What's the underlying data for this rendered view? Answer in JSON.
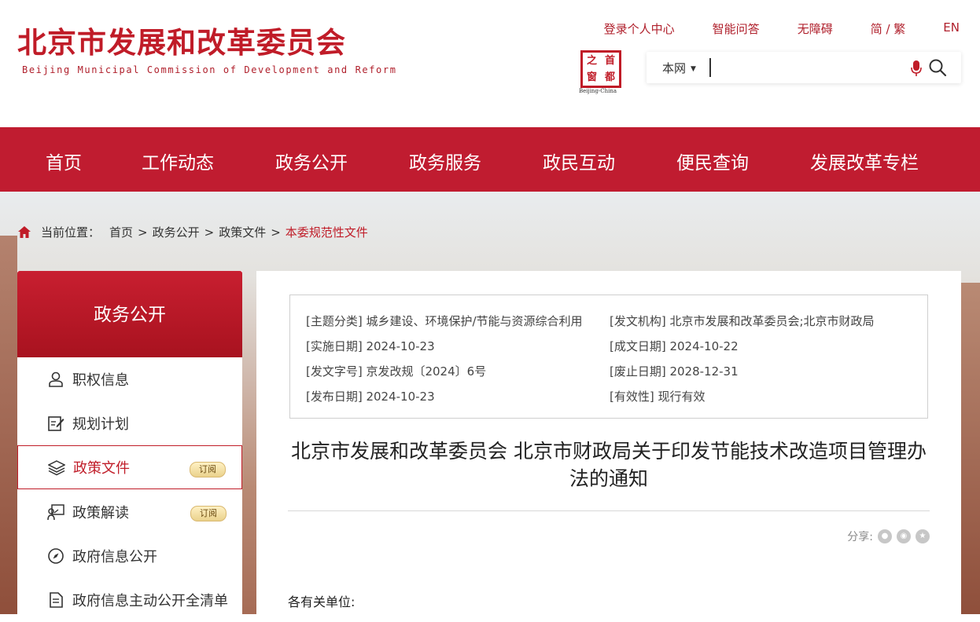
{
  "header": {
    "site_title": "北京市发展和改革委员会",
    "site_subtitle": "Beijing Municipal Commission of Development and Reform",
    "top_links": [
      "登录个人中心",
      "智能问答",
      "无障碍",
      "简 / 繁",
      "EN"
    ],
    "seal_chars": [
      "之",
      "首",
      "窗",
      "都"
    ],
    "seal_caption": "Beijing-China",
    "search_scope": "本网",
    "search_value": ""
  },
  "nav": {
    "items": [
      "首页",
      "工作动态",
      "政务公开",
      "政务服务",
      "政民互动",
      "便民查询",
      "发展改革专栏"
    ]
  },
  "breadcrumb": {
    "prefix": "当前位置：",
    "items": [
      "首页",
      "政务公开",
      "政策文件"
    ],
    "current": "本委规范性文件"
  },
  "sidebar": {
    "title": "政务公开",
    "items": [
      {
        "label": "职权信息",
        "icon": "person-icon",
        "badge": ""
      },
      {
        "label": "规划计划",
        "icon": "edit-doc-icon",
        "badge": ""
      },
      {
        "label": "政策文件",
        "icon": "layers-icon",
        "badge": "订阅"
      },
      {
        "label": "政策解读",
        "icon": "presenter-icon",
        "badge": "订阅"
      },
      {
        "label": "政府信息公开",
        "icon": "compass-icon",
        "badge": ""
      },
      {
        "label": "政府信息主动公开全清单",
        "icon": "document-icon",
        "badge": ""
      }
    ],
    "active_index": 2
  },
  "meta": {
    "topic": "[主题分类] 城乡建设、环境保护/节能与资源综合利用",
    "issuer": "[发文机构] 北京市发展和改革委员会;北京市财政局",
    "effective_date": "[实施日期] 2024-10-23",
    "written_date": "[成文日期] 2024-10-22",
    "doc_number": "[发文字号] 京发改规〔2024〕6号",
    "expiry_date": "[废止日期] 2028-12-31",
    "publish_date": "[发布日期] 2024-10-23",
    "validity": "[有效性] 现行有效"
  },
  "article": {
    "title": "北京市发展和改革委员会 北京市财政局关于印发节能技术改造项目管理办法的通知",
    "share_label": "分享:",
    "salutation": "各有关单位:"
  },
  "colors": {
    "brand_red": "#c01c30",
    "accent_red": "#c01c28"
  }
}
